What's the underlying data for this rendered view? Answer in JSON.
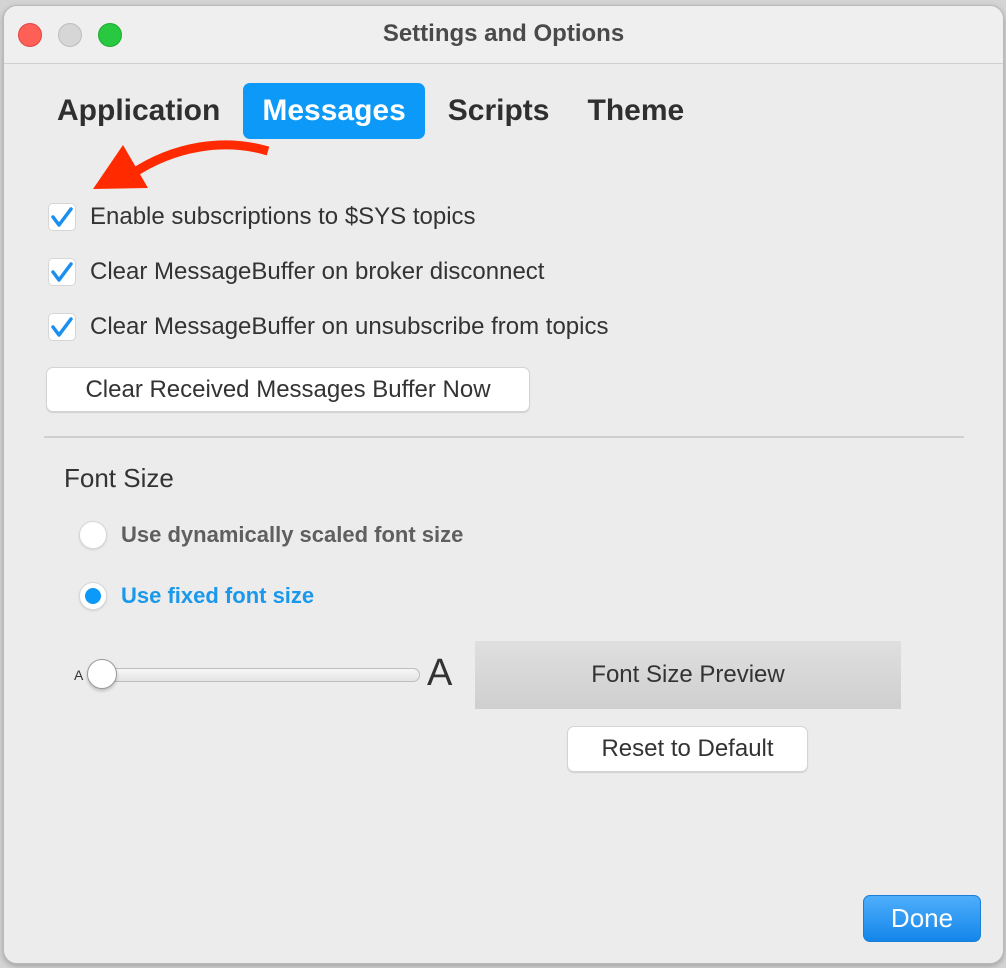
{
  "window": {
    "title": "Settings and Options",
    "controls": {
      "close": "close-window",
      "minimize": "minimize-window",
      "maximize": "maximize-window"
    }
  },
  "tabs": [
    {
      "label": "Application",
      "active": false
    },
    {
      "label": "Messages",
      "active": true
    },
    {
      "label": "Scripts",
      "active": false
    },
    {
      "label": "Theme",
      "active": false
    }
  ],
  "annotation": {
    "type": "arrow",
    "color": "#ff2a00",
    "points_to": "Enable subscriptions to $SYS topics"
  },
  "messages": {
    "options": [
      {
        "label": "Enable subscriptions to $SYS topics",
        "checked": true
      },
      {
        "label": "Clear MessageBuffer on broker disconnect",
        "checked": true
      },
      {
        "label": "Clear MessageBuffer on unsubscribe from topics",
        "checked": true
      }
    ],
    "clear_button": "Clear Received Messages Buffer Now"
  },
  "font_size": {
    "title": "Font Size",
    "options": [
      {
        "label": "Use dynamically scaled font size",
        "selected": false
      },
      {
        "label": "Use fixed font size",
        "selected": true
      }
    ],
    "slider": {
      "min_label": "A",
      "max_label": "A",
      "value_fraction": 0.0
    },
    "preview_text": "Font Size Preview",
    "reset_button": "Reset to Default"
  },
  "footer": {
    "done_button": "Done"
  },
  "colors": {
    "accent": "#0d99f7",
    "selected_text": "#1a98eb",
    "arrow": "#ff2a00"
  }
}
